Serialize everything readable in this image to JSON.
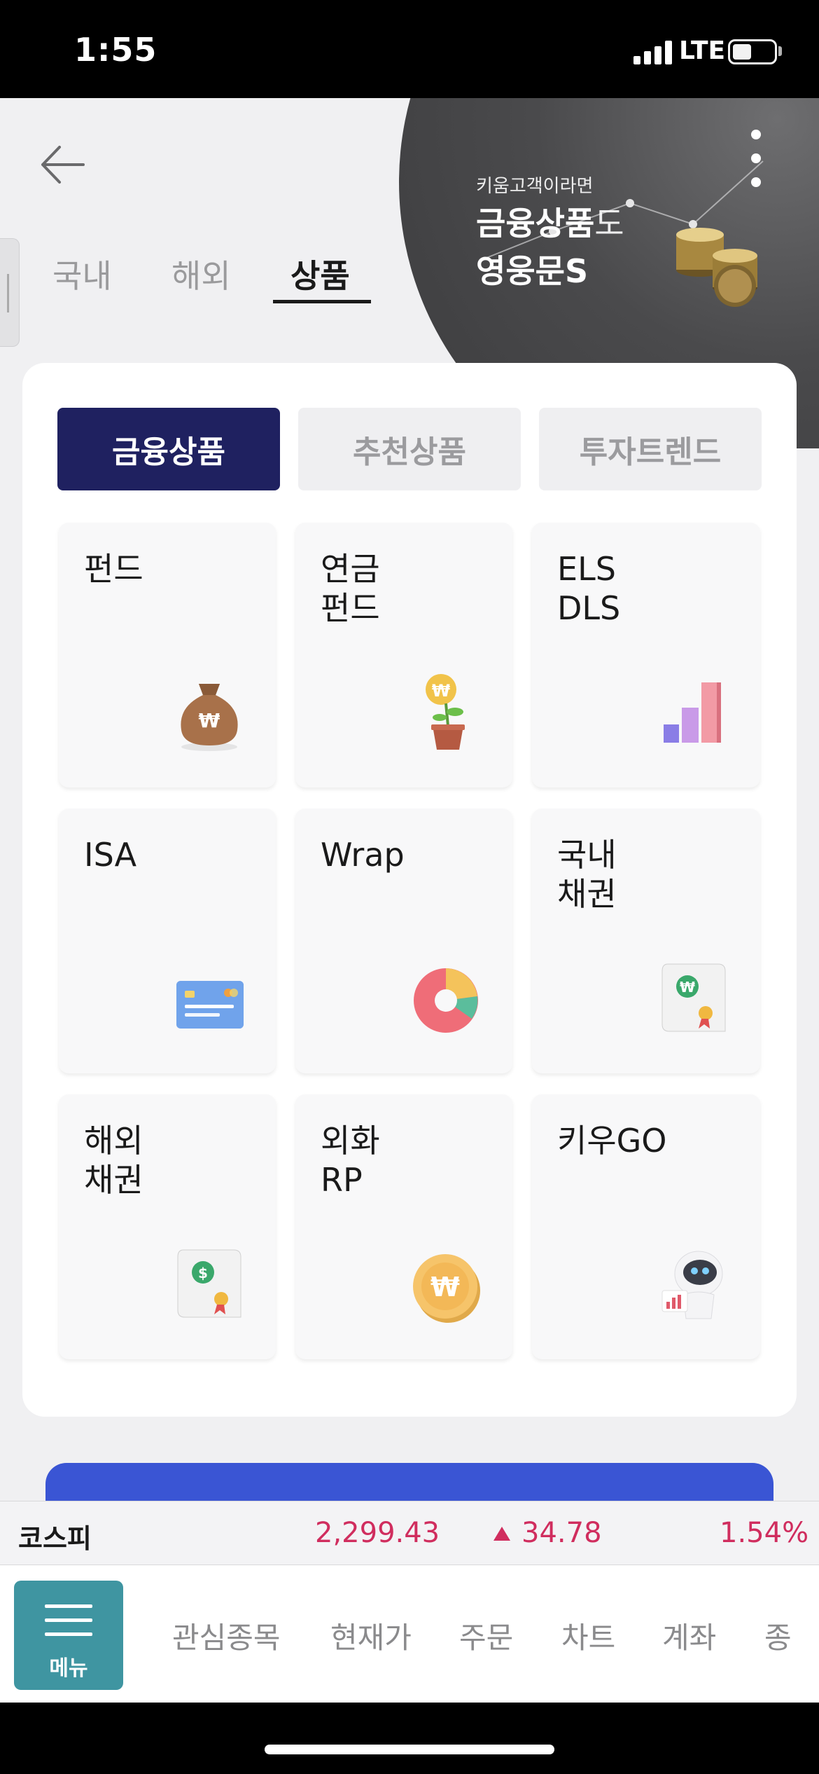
{
  "status": {
    "time": "1:55",
    "network": "LTE"
  },
  "banner": {
    "small": "키움고객이라면",
    "line1_main": "금융상품",
    "line1_suffix": "도",
    "line2": "영웅문S"
  },
  "top_tabs": [
    {
      "label": "국내"
    },
    {
      "label": "해외"
    },
    {
      "label": "상품",
      "active": true
    }
  ],
  "segments": [
    {
      "label": "금융상품",
      "active": true
    },
    {
      "label": "추천상품"
    },
    {
      "label": "투자트렌드"
    }
  ],
  "tiles": [
    {
      "label": "펀드",
      "icon": "money-bag-icon"
    },
    {
      "label": "연금\n펀드",
      "icon": "plant-coin-icon"
    },
    {
      "label": "ELS\nDLS",
      "icon": "bar-chart-icon"
    },
    {
      "label": "ISA",
      "icon": "credit-card-icon"
    },
    {
      "label": "Wrap",
      "icon": "pie-chart-icon"
    },
    {
      "label": "국내\n채권",
      "icon": "won-certificate-icon"
    },
    {
      "label": "해외\n채권",
      "icon": "dollar-certificate-icon"
    },
    {
      "label": "외화\nRP",
      "icon": "won-coin-icon"
    },
    {
      "label": "키우GO",
      "icon": "robot-icon"
    }
  ],
  "ticker": {
    "name": "코스피",
    "value": "2,299.43",
    "change": "34.78",
    "percent": "1.54%",
    "direction": "up",
    "color": "#d02d5e"
  },
  "bottom_nav": {
    "menu_label": "메뉴",
    "items": [
      "관심종목",
      "현재가",
      "주문",
      "차트",
      "계좌",
      "종"
    ]
  },
  "colors": {
    "segment_active": "#1f2160",
    "menu_button": "#3f95a1",
    "promo_strip": "#3a55d4"
  }
}
